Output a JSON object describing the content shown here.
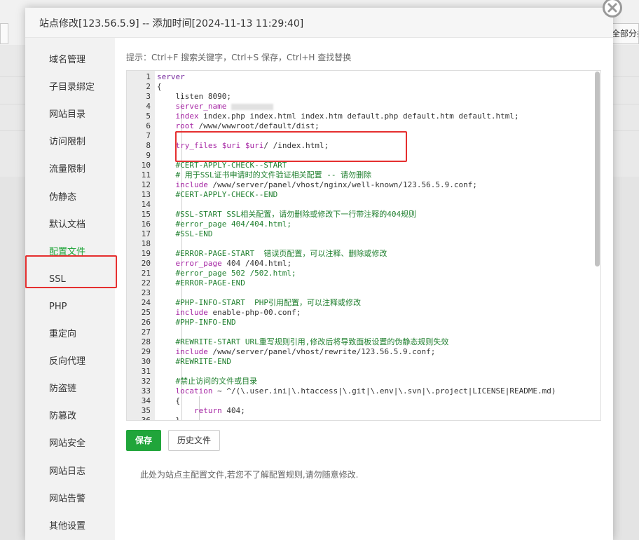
{
  "background": {
    "right_button_label": "全部分类"
  },
  "dialog": {
    "title": "站点修改[123.56.5.9] -- 添加时间[2024-11-13 11:29:40]"
  },
  "sidebar": {
    "items": [
      {
        "label": "域名管理"
      },
      {
        "label": "子目录绑定"
      },
      {
        "label": "网站目录"
      },
      {
        "label": "访问限制"
      },
      {
        "label": "流量限制"
      },
      {
        "label": "伪静态"
      },
      {
        "label": "默认文档"
      },
      {
        "label": "配置文件",
        "active": true
      },
      {
        "label": "SSL"
      },
      {
        "label": "PHP"
      },
      {
        "label": "重定向"
      },
      {
        "label": "反向代理"
      },
      {
        "label": "防盗链"
      },
      {
        "label": "防篡改"
      },
      {
        "label": "网站安全"
      },
      {
        "label": "网站日志"
      },
      {
        "label": "网站告警"
      },
      {
        "label": "其他设置"
      }
    ]
  },
  "editor": {
    "hint": "提示：Ctrl+F 搜索关键字，Ctrl+S 保存，Ctrl+H 查找替换",
    "lines": [
      {
        "n": "1",
        "parts": [
          {
            "t": "server",
            "c": "sv"
          }
        ]
      },
      {
        "n": "2",
        "parts": [
          {
            "t": "{"
          }
        ]
      },
      {
        "n": "3",
        "parts": [
          {
            "t": "    listen 8090;"
          }
        ]
      },
      {
        "n": "4",
        "parts": [
          {
            "t": "    "
          },
          {
            "t": "server_name",
            "c": "kw"
          },
          {
            "t": " "
          }
        ],
        "blurred": true
      },
      {
        "n": "5",
        "parts": [
          {
            "t": "    "
          },
          {
            "t": "index",
            "c": "kw"
          },
          {
            "t": " index.php index.html index.htm default.php default.htm default.html;"
          }
        ]
      },
      {
        "n": "6",
        "parts": [
          {
            "t": "    "
          },
          {
            "t": "root",
            "c": "kw"
          },
          {
            "t": " /www/wwwroot/default/dist;"
          }
        ]
      },
      {
        "n": "7",
        "parts": [
          {
            "t": ""
          }
        ]
      },
      {
        "n": "8",
        "parts": [
          {
            "t": "    "
          },
          {
            "t": "try_files",
            "c": "kw"
          },
          {
            "t": " "
          },
          {
            "t": "$uri",
            "c": "kw"
          },
          {
            "t": " "
          },
          {
            "t": "$uri",
            "c": "kw"
          },
          {
            "t": "/ /index.html;"
          }
        ]
      },
      {
        "n": "9",
        "parts": [
          {
            "t": ""
          }
        ]
      },
      {
        "n": "10",
        "parts": [
          {
            "t": "    #CERT-APPLY-CHECK--START",
            "c": "cm"
          }
        ]
      },
      {
        "n": "11",
        "parts": [
          {
            "t": "    # 用于SSL证书申请时的文件验证相关配置 -- 请勿删除",
            "c": "cm"
          }
        ]
      },
      {
        "n": "12",
        "parts": [
          {
            "t": "    "
          },
          {
            "t": "include",
            "c": "kw"
          },
          {
            "t": " /www/server/panel/vhost/nginx/well-known/123.56.5.9.conf;"
          }
        ]
      },
      {
        "n": "13",
        "parts": [
          {
            "t": "    #CERT-APPLY-CHECK--END",
            "c": "cm"
          }
        ]
      },
      {
        "n": "14",
        "parts": [
          {
            "t": ""
          }
        ]
      },
      {
        "n": "15",
        "parts": [
          {
            "t": "    #SSL-START SSL相关配置，请勿删除或修改下一行带注释的404规则",
            "c": "cm"
          }
        ]
      },
      {
        "n": "16",
        "parts": [
          {
            "t": "    #error_page 404/404.html;",
            "c": "cm"
          }
        ]
      },
      {
        "n": "17",
        "parts": [
          {
            "t": "    #SSL-END",
            "c": "cm"
          }
        ]
      },
      {
        "n": "18",
        "parts": [
          {
            "t": ""
          }
        ]
      },
      {
        "n": "19",
        "parts": [
          {
            "t": "    #ERROR-PAGE-START  错误页配置，可以注释、删除或修改",
            "c": "cm"
          }
        ]
      },
      {
        "n": "20",
        "parts": [
          {
            "t": "    "
          },
          {
            "t": "error_page",
            "c": "kw"
          },
          {
            "t": " 404 /404.html;"
          }
        ]
      },
      {
        "n": "21",
        "parts": [
          {
            "t": "    #error_page 502 /502.html;",
            "c": "cm"
          }
        ]
      },
      {
        "n": "22",
        "parts": [
          {
            "t": "    #ERROR-PAGE-END",
            "c": "cm"
          }
        ]
      },
      {
        "n": "23",
        "parts": [
          {
            "t": ""
          }
        ]
      },
      {
        "n": "24",
        "parts": [
          {
            "t": "    #PHP-INFO-START  PHP引用配置，可以注释或修改",
            "c": "cm"
          }
        ]
      },
      {
        "n": "25",
        "parts": [
          {
            "t": "    "
          },
          {
            "t": "include",
            "c": "kw"
          },
          {
            "t": " enable-php-00.conf;"
          }
        ]
      },
      {
        "n": "26",
        "parts": [
          {
            "t": "    #PHP-INFO-END",
            "c": "cm"
          }
        ]
      },
      {
        "n": "27",
        "parts": [
          {
            "t": ""
          }
        ]
      },
      {
        "n": "28",
        "parts": [
          {
            "t": "    #REWRITE-START URL重写规则引用,修改后将导致面板设置的伪静态规则失效",
            "c": "cm"
          }
        ]
      },
      {
        "n": "29",
        "parts": [
          {
            "t": "    "
          },
          {
            "t": "include",
            "c": "kw"
          },
          {
            "t": " /www/server/panel/vhost/rewrite/123.56.5.9.conf;"
          }
        ]
      },
      {
        "n": "30",
        "parts": [
          {
            "t": "    #REWRITE-END",
            "c": "cm"
          }
        ]
      },
      {
        "n": "31",
        "parts": [
          {
            "t": ""
          }
        ]
      },
      {
        "n": "32",
        "parts": [
          {
            "t": "    #禁止访问的文件或目录",
            "c": "cm"
          }
        ]
      },
      {
        "n": "33",
        "parts": [
          {
            "t": "    "
          },
          {
            "t": "location",
            "c": "kw"
          },
          {
            "t": " ~ ^/(\\.user.ini|\\.htaccess|\\.git|\\.env|\\.svn|\\.project|LICENSE|README.md)"
          }
        ]
      },
      {
        "n": "34",
        "parts": [
          {
            "t": "    {"
          }
        ]
      },
      {
        "n": "35",
        "parts": [
          {
            "t": "        "
          },
          {
            "t": "return",
            "c": "kw"
          },
          {
            "t": " 404;"
          }
        ]
      },
      {
        "n": "36",
        "parts": [
          {
            "t": "    }"
          }
        ]
      }
    ]
  },
  "actions": {
    "save_label": "保存",
    "history_label": "历史文件"
  },
  "note": "此处为站点主配置文件,若您不了解配置规则,请勿随意修改."
}
